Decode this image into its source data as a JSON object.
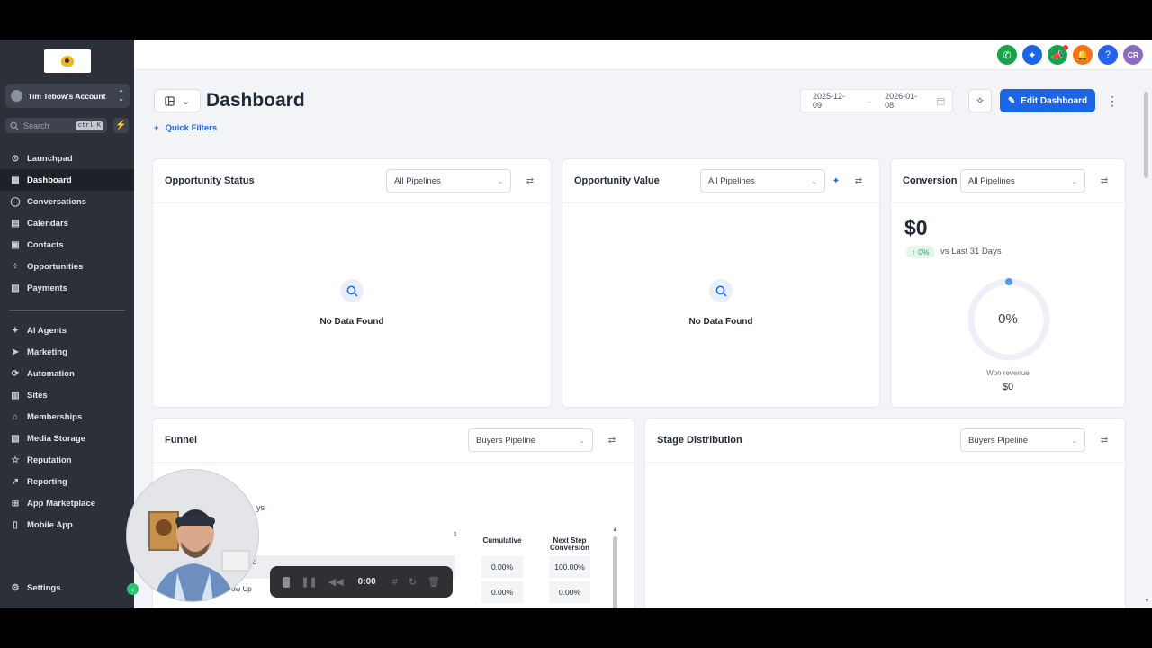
{
  "sidebar": {
    "account_name": "Tim Tebow's Account",
    "search_placeholder": "Search",
    "search_shortcut": "ctrl K",
    "nav_main": [
      {
        "label": "Launchpad",
        "icon": "rocket-icon"
      },
      {
        "label": "Dashboard",
        "icon": "grid-icon",
        "active": true
      },
      {
        "label": "Conversations",
        "icon": "chat-icon"
      },
      {
        "label": "Calendars",
        "icon": "calendar-icon"
      },
      {
        "label": "Contacts",
        "icon": "contacts-icon"
      },
      {
        "label": "Opportunities",
        "icon": "opportunities-icon"
      },
      {
        "label": "Payments",
        "icon": "payments-icon"
      }
    ],
    "nav_secondary": [
      {
        "label": "AI Agents",
        "icon": "sparkle-icon"
      },
      {
        "label": "Marketing",
        "icon": "send-icon"
      },
      {
        "label": "Automation",
        "icon": "automation-icon"
      },
      {
        "label": "Sites",
        "icon": "sites-icon"
      },
      {
        "label": "Memberships",
        "icon": "memberships-icon"
      },
      {
        "label": "Media Storage",
        "icon": "media-icon"
      },
      {
        "label": "Reputation",
        "icon": "star-icon"
      },
      {
        "label": "Reporting",
        "icon": "trend-icon"
      },
      {
        "label": "App Marketplace",
        "icon": "apps-icon"
      },
      {
        "label": "Mobile App",
        "icon": "mobile-icon"
      }
    ],
    "settings_label": "Settings"
  },
  "topbar": {
    "avatar_initials": "CR",
    "colors": {
      "phone": "#16a34a",
      "magic": "#1c66e6",
      "megaphone": "#16a34a",
      "bell": "#f97316",
      "help": "#2563eb",
      "avatar": "#8b6cc1"
    }
  },
  "header": {
    "title": "Dashboard",
    "date_start": "2025-12-09",
    "date_end": "2026-01-08",
    "edit_label": "Edit Dashboard",
    "quick_filters_label": "Quick Filters"
  },
  "cards": {
    "opportunity_status": {
      "title": "Opportunity Status",
      "filter": "All Pipelines",
      "empty": "No Data Found"
    },
    "opportunity_value": {
      "title": "Opportunity Value",
      "filter": "All Pipelines",
      "empty": "No Data Found"
    },
    "conversion": {
      "title": "Conversion",
      "filter": "All Pipelines",
      "value": "$0",
      "change": "0%",
      "compare": "vs Last 31 Days",
      "gauge_percent": "0%",
      "won_label": "Won revenue",
      "won_value": "$0",
      "progress_fraction": 0
    },
    "funnel": {
      "title": "Funnel",
      "filter": "Buyers Pipeline",
      "partial_text_1": "ys",
      "partial_text_2": "d",
      "partial_text_3": "ow Up",
      "axis_tick": "1",
      "columns": [
        "Cumulative",
        "Next Step Conversion"
      ],
      "rows": [
        [
          "0.00%",
          "100.00%"
        ],
        [
          "0.00%",
          "0.00%"
        ]
      ]
    },
    "stage_distribution": {
      "title": "Stage Distribution",
      "filter": "Buyers Pipeline"
    }
  },
  "recorder": {
    "time": "0:00"
  },
  "colors": {
    "accent": "#1c66e6",
    "sidebar_bg": "#2b3039",
    "positive": "#1fae53"
  }
}
